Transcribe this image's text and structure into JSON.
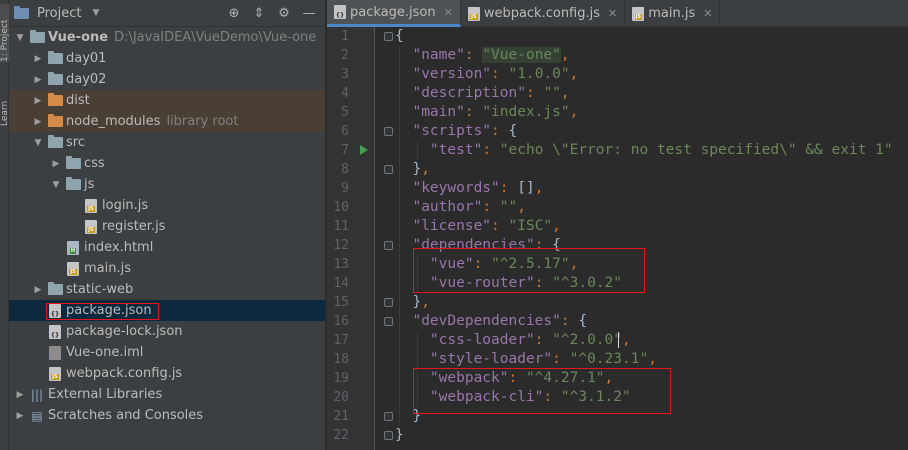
{
  "tool_strip": {
    "project_label": "1: Project",
    "learn_label": "Learn"
  },
  "project_panel": {
    "title": "Project",
    "rows": [
      {
        "name": "Vue-one",
        "hint": "D:\\JavaIDEA\\VueDemo\\Vue-one",
        "depth": 0,
        "expanded": true,
        "type": "module"
      },
      {
        "name": "day01",
        "depth": 1,
        "expanded": false,
        "type": "folder"
      },
      {
        "name": "day02",
        "depth": 1,
        "expanded": false,
        "type": "folder"
      },
      {
        "name": "dist",
        "depth": 1,
        "expanded": false,
        "type": "folder-excluded"
      },
      {
        "name": "node_modules",
        "hint": "library root",
        "depth": 1,
        "expanded": false,
        "type": "folder-excluded"
      },
      {
        "name": "src",
        "depth": 1,
        "expanded": true,
        "type": "folder"
      },
      {
        "name": "css",
        "depth": 2,
        "expanded": false,
        "type": "folder"
      },
      {
        "name": "js",
        "depth": 2,
        "expanded": true,
        "type": "folder"
      },
      {
        "name": "login.js",
        "depth": 3,
        "type": "js"
      },
      {
        "name": "register.js",
        "depth": 3,
        "type": "js"
      },
      {
        "name": "index.html",
        "depth": 2,
        "type": "html"
      },
      {
        "name": "main.js",
        "depth": 2,
        "type": "js"
      },
      {
        "name": "static-web",
        "depth": 1,
        "expanded": false,
        "type": "folder"
      },
      {
        "name": "package.json",
        "depth": 1,
        "type": "json",
        "selected": true
      },
      {
        "name": "package-lock.json",
        "depth": 1,
        "type": "json"
      },
      {
        "name": "Vue-one.iml",
        "depth": 1,
        "type": "iml"
      },
      {
        "name": "webpack.config.js",
        "depth": 1,
        "type": "js"
      },
      {
        "name": "External Libraries",
        "depth": 0,
        "expanded": false,
        "type": "library"
      },
      {
        "name": "Scratches and Consoles",
        "depth": 0,
        "expanded": false,
        "type": "scratch"
      }
    ]
  },
  "editor": {
    "tabs": [
      {
        "label": "package.json",
        "active": true
      },
      {
        "label": "webpack.config.js",
        "active": false
      },
      {
        "label": "main.js",
        "active": false
      }
    ],
    "lines": [
      "{",
      "  \"name\": \"Vue-one\",",
      "  \"version\": \"1.0.0\",",
      "  \"description\": \"\",",
      "  \"main\": \"index.js\",",
      "  \"scripts\": {",
      "    \"test\": \"echo \\\"Error: no test specified\\\" && exit 1\"",
      "  },",
      "  \"keywords\": [],",
      "  \"author\": \"\",",
      "  \"license\": \"ISC\",",
      "  \"dependencies\": {",
      "    \"vue\": \"^2.5.17\",",
      "    \"vue-router\": \"^3.0.2\"",
      "  },",
      "  \"devDependencies\": {",
      "    \"css-loader\": \"^2.0.0\",",
      "    \"style-loader\": \"^0.23.1\",",
      "    \"webpack\": \"^4.27.1\",",
      "    \"webpack-cli\": \"^3.1.2\"",
      "  }",
      "}"
    ]
  },
  "colors": {
    "key": "#9876aa",
    "string": "#6a8759",
    "punct": "#cc7832",
    "highlight_box": "#e5141d",
    "selection": "#0d293e"
  }
}
